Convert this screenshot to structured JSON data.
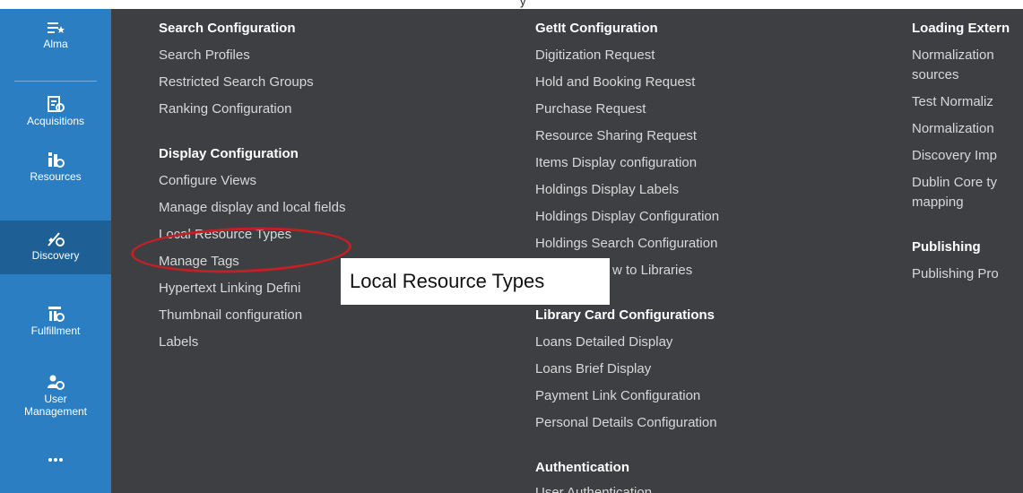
{
  "top_text": "y",
  "nav": {
    "items": [
      {
        "label": "Alma",
        "icon": "alma-star-menu-icon"
      },
      {
        "label": "Acquisitions",
        "icon": "acquisitions-icon"
      },
      {
        "label": "Resources",
        "icon": "resources-icon"
      },
      {
        "label": "Discovery",
        "icon": "discovery-icon",
        "active": true
      },
      {
        "label": "Fulfillment",
        "icon": "fulfillment-icon"
      },
      {
        "label": "User Management",
        "label_lines": [
          "User",
          "Management"
        ],
        "icon": "user-management-icon"
      },
      {
        "label": "",
        "icon": "more-dots-icon"
      }
    ]
  },
  "columns": {
    "col1": {
      "search_configuration": {
        "heading": "Search Configuration",
        "links": [
          "Search Profiles",
          "Restricted Search Groups",
          "Ranking Configuration"
        ]
      },
      "display_configuration": {
        "heading": "Display Configuration",
        "links": [
          "Configure Views",
          "Manage display and local fields",
          "Local Resource Types",
          "Manage Tags",
          "Hypertext Linking Defini",
          "Thumbnail configuration",
          "Labels"
        ]
      }
    },
    "col2": {
      "getit_configuration": {
        "heading": "GetIt Configuration",
        "links": [
          "Digitization Request",
          "Hold and Booking Request",
          "Purchase Request",
          "Resource Sharing Request",
          "Items Display configuration",
          "Holdings Display Labels",
          "Holdings Display Configuration",
          "Holdings Search Configuration",
          "w to Libraries"
        ]
      },
      "library_card_configurations": {
        "heading": "Library Card Configurations",
        "links": [
          "Loans Detailed Display",
          "Loans Brief Display",
          "Payment Link Configuration",
          "Personal Details Configuration"
        ]
      },
      "authentication": {
        "heading": "Authentication",
        "links": [
          "User Authentication"
        ]
      }
    },
    "col3": {
      "loading_external": {
        "heading": "Loading Extern",
        "links": [
          "Normalization",
          "sources",
          "Test Normaliz",
          "Normalization",
          "Discovery Imp",
          "Dublin Core ty",
          "mapping"
        ]
      },
      "publishing": {
        "heading": "Publishing",
        "links": [
          "Publishing Pro"
        ]
      }
    }
  },
  "callout": {
    "text": "Local Resource Types"
  },
  "colors": {
    "rail": "#2b7ec1",
    "rail_active": "#1e5f95",
    "background": "#3d3f43",
    "highlight_ellipse": "#c32025"
  }
}
